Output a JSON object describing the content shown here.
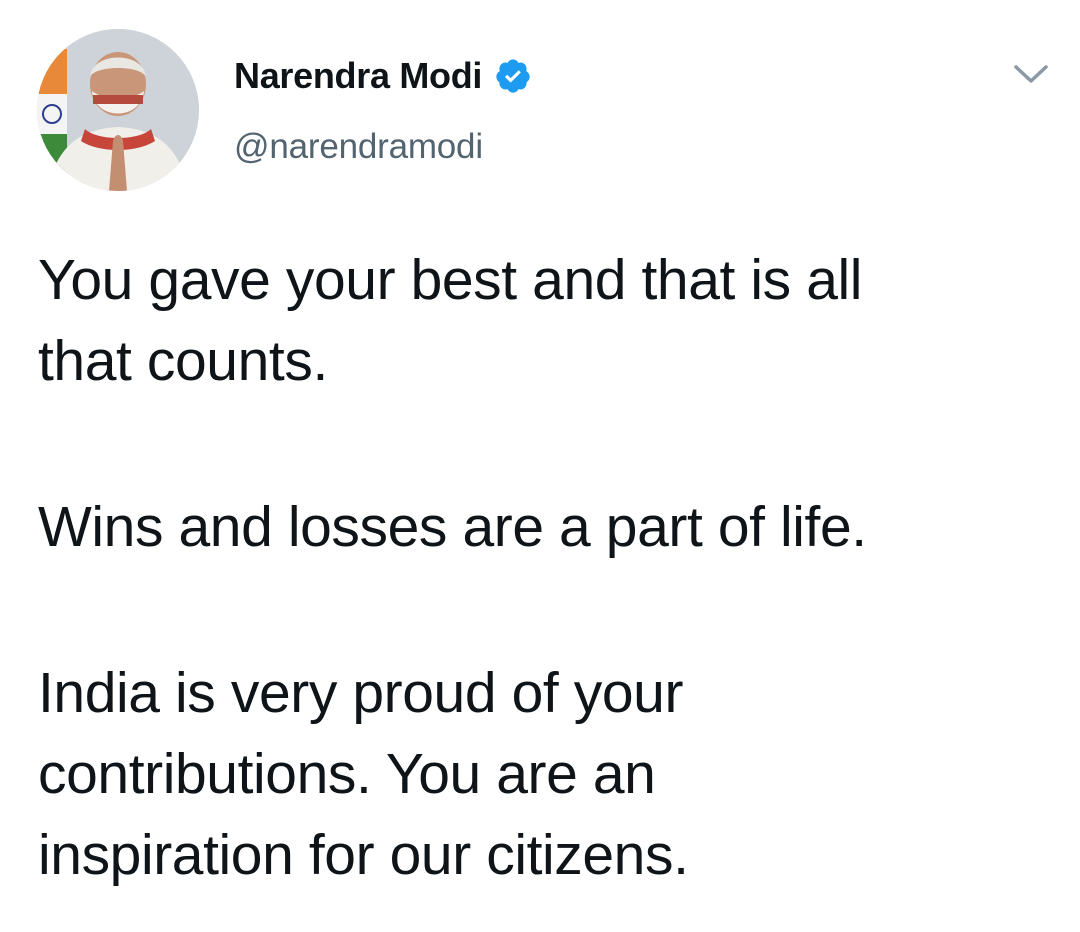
{
  "tweet": {
    "author": {
      "display_name": "Narendra Modi",
      "handle": "@narendramodi",
      "verified": true,
      "avatar": "profile-photo"
    },
    "menu_icon": "chevron-down-icon",
    "paragraphs": [
      [
        "You gave your best and that is all",
        "that counts."
      ],
      [
        "Wins and losses are a part of life."
      ],
      [
        "India is very proud of your",
        "contributions. You are an",
        "inspiration for our citizens."
      ]
    ]
  },
  "colors": {
    "text_primary": "#0f1419",
    "text_secondary": "#536471",
    "verified_blue": "#1d9bf0",
    "caret_gray": "#8b98a5",
    "background": "#ffffff"
  }
}
